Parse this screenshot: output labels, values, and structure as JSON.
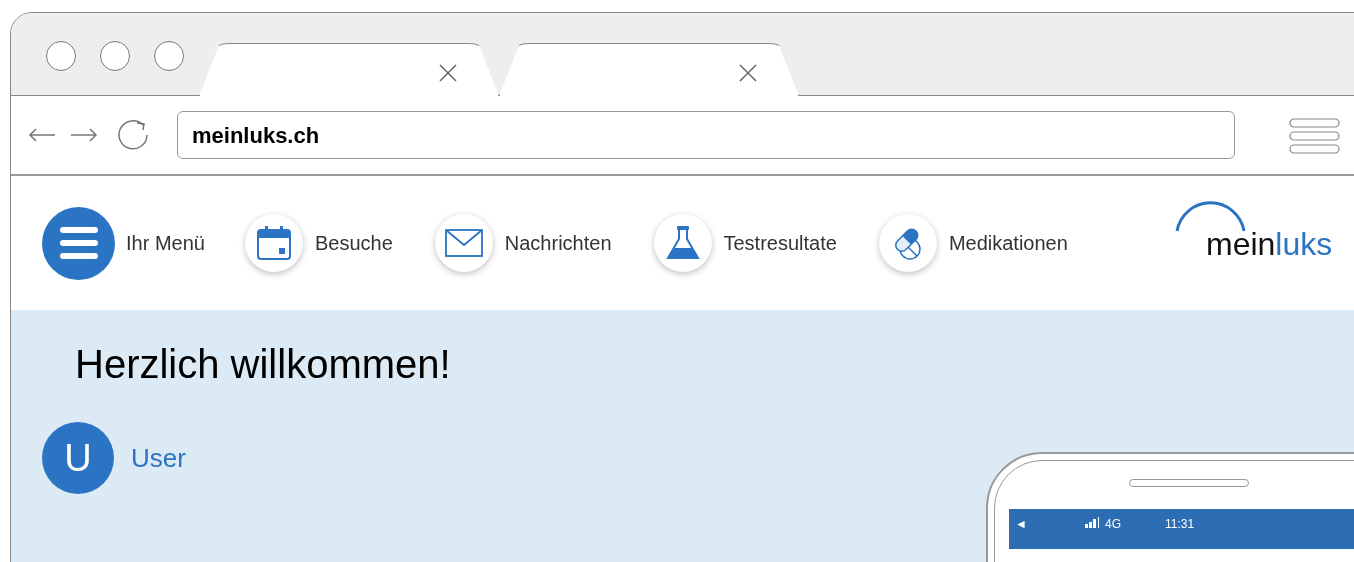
{
  "browser": {
    "address": "meinluks.ch"
  },
  "nav": {
    "items": [
      {
        "kind": "menu",
        "label": "Ihr Menü"
      },
      {
        "kind": "link",
        "label": "Besuche"
      },
      {
        "kind": "link",
        "label": "Nachrichten"
      },
      {
        "kind": "link",
        "label": "Testresultate"
      },
      {
        "kind": "link",
        "label": "Medikationen"
      }
    ],
    "logo": {
      "part_1": "mein",
      "part_2": "luks"
    }
  },
  "welcome": {
    "heading": "Herzlich willkommen!",
    "avatar_letter": "U",
    "user_name": "User"
  },
  "phone": {
    "status_bar": {
      "back": "◄",
      "network": "4G",
      "time": "11:31"
    }
  }
}
